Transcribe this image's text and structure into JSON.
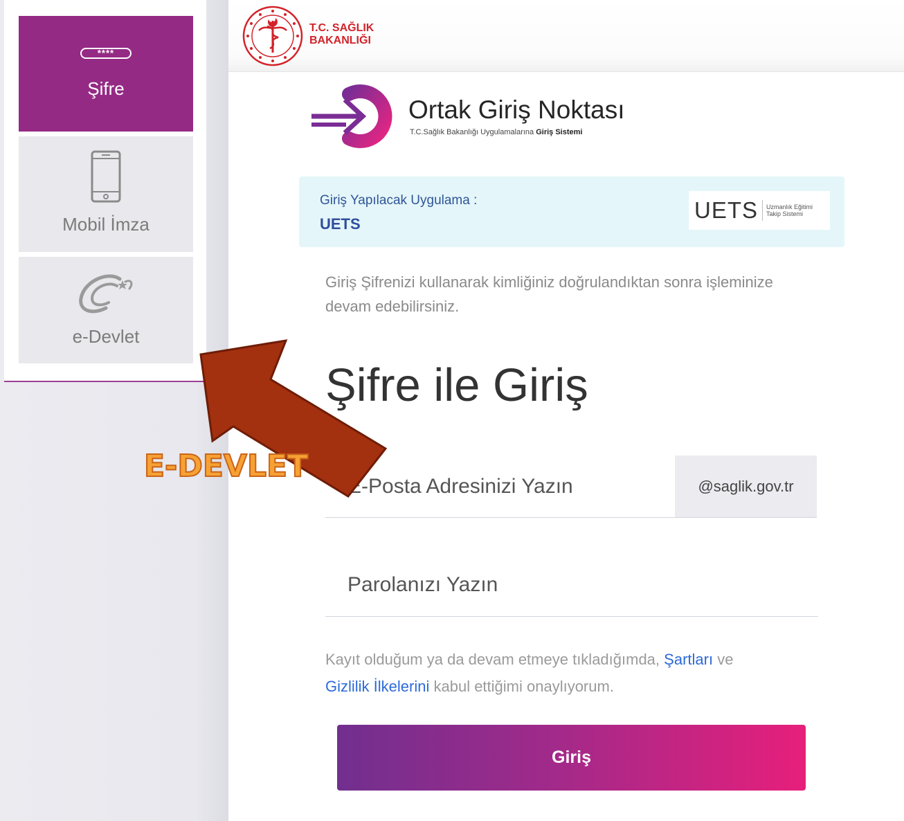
{
  "sidebar": {
    "items": [
      {
        "label": "Şifre",
        "icon": "password-icon",
        "icon_text": "****",
        "active": true
      },
      {
        "label": "Mobil İmza",
        "icon": "mobile-phone-icon",
        "active": false
      },
      {
        "label": "e-Devlet",
        "icon": "e-devlet-icon",
        "active": false
      }
    ]
  },
  "header": {
    "ministry_line1": "T.C. SAĞLIK",
    "ministry_line2": "BAKANLIĞI"
  },
  "brand": {
    "title": "Ortak Giriş Noktası",
    "subtitle_prefix": "T.C.Sağlık Bakanlığı Uygulamalarına",
    "subtitle_bold": "Giriş Sistemi"
  },
  "app_box": {
    "label": "Giriş Yapılacak Uygulama :",
    "app_name": "UETS",
    "logo_text": "UETS",
    "logo_sub1": "Uzmanlık Eğitimi",
    "logo_sub2": "Takip Sistemi"
  },
  "info_text": "Giriş Şifrenizi kullanarak kimliğiniz doğrulandıktan sonra işleminize devam edebilirsiniz.",
  "login": {
    "title": "Şifre ile Giriş",
    "email_placeholder": "E-Posta Adresinizi Yazın",
    "email_domain": "@saglik.gov.tr",
    "password_placeholder": "Parolanızı Yazın",
    "terms_pre": "Kayıt olduğum ya da devam etmeye tıkladığımda,",
    "terms_link1": "Şartları",
    "terms_mid": "ve",
    "terms_link2": "Gizlilik İlkelerini",
    "terms_post": "kabul ettiğimi onaylıyorum.",
    "submit_label": "Giriş"
  },
  "annotation": {
    "label": "E-DEVLET"
  },
  "colors": {
    "purple": "#952a85",
    "ministry_red": "#d2232a",
    "link_blue": "#2d6ad8",
    "arrow": "#a3300f",
    "annotation_text": "#f7a133"
  }
}
